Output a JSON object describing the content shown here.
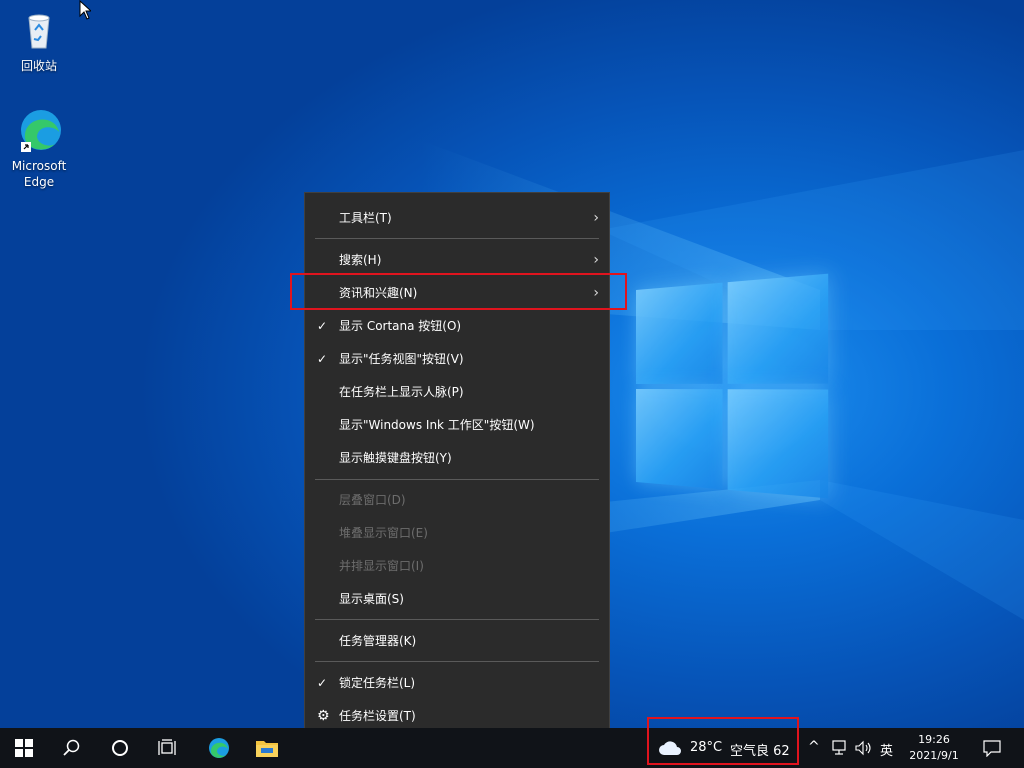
{
  "desktop": {
    "icons": [
      {
        "label": "回收站",
        "icon": "recycle-bin-icon"
      },
      {
        "label": "Microsoft Edge",
        "icon": "edge-icon"
      }
    ]
  },
  "context_menu": {
    "items": [
      {
        "label": "工具栏(T)",
        "has_submenu": true
      },
      {
        "label": "搜索(H)",
        "has_submenu": true
      },
      {
        "label": "资讯和兴趣(N)",
        "has_submenu": true,
        "highlighted_box": true
      },
      {
        "label": "显示 Cortana 按钮(O)",
        "checked": true
      },
      {
        "label": "显示\"任务视图\"按钮(V)",
        "checked": true
      },
      {
        "label": "在任务栏上显示人脉(P)"
      },
      {
        "label": "显示\"Windows Ink 工作区\"按钮(W)"
      },
      {
        "label": "显示触摸键盘按钮(Y)"
      },
      {
        "label": "层叠窗口(D)",
        "disabled": true
      },
      {
        "label": "堆叠显示窗口(E)",
        "disabled": true
      },
      {
        "label": "并排显示窗口(I)",
        "disabled": true
      },
      {
        "label": "显示桌面(S)"
      },
      {
        "label": "任务管理器(K)"
      },
      {
        "label": "锁定任务栏(L)",
        "checked": true
      },
      {
        "label": "任务栏设置(T)",
        "icon": "gear-icon"
      }
    ]
  },
  "taskbar": {
    "buttons": [
      "start-icon",
      "search-icon",
      "cortana-icon",
      "task-view-icon",
      "edge-icon",
      "file-explorer-icon"
    ],
    "weather": {
      "temp": "28°C",
      "air": "空气良 62"
    },
    "tray": {
      "chevron": "^",
      "ime": "英"
    },
    "clock": {
      "time": "19:26",
      "date": "2021/9/1"
    }
  },
  "colors": {
    "highlight_border": "#e0141e",
    "menu_bg": "#2b2b2b",
    "taskbar_bg": "#101318"
  }
}
